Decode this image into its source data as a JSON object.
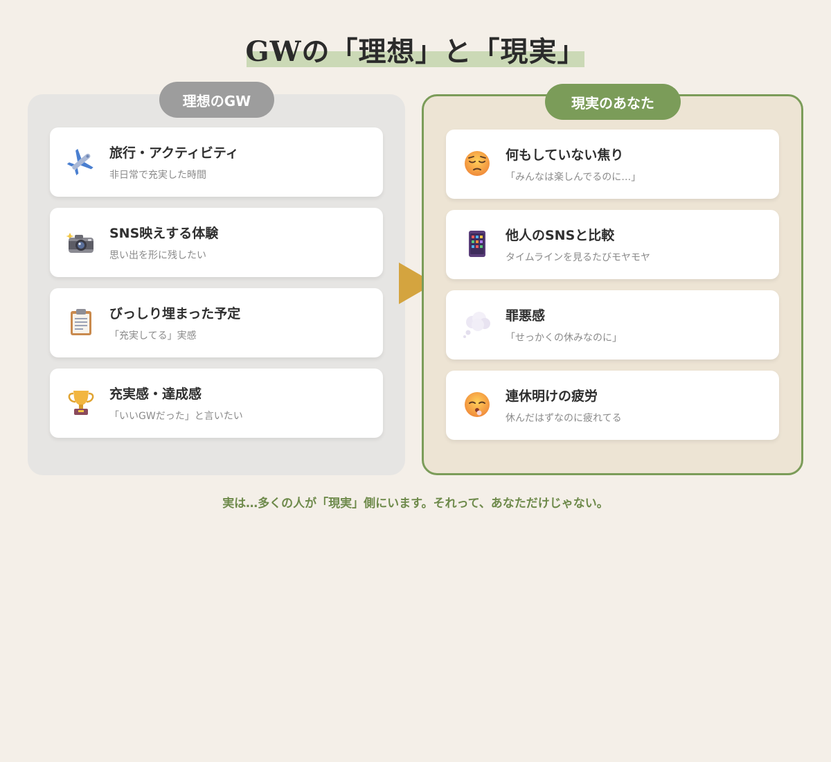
{
  "title": "GWの「理想」と「現実」",
  "left": {
    "label": "理想のGW",
    "items": [
      {
        "icon": "airplane-icon",
        "title": "旅行・アクティビティ",
        "subtitle": "非日常で充実した時間"
      },
      {
        "icon": "camera-flash-icon",
        "title": "SNS映えする体験",
        "subtitle": "思い出を形に残したい"
      },
      {
        "icon": "clipboard-icon",
        "title": "びっしり埋まった予定",
        "subtitle": "「充実してる」実感"
      },
      {
        "icon": "trophy-icon",
        "title": "充実感・達成感",
        "subtitle": "「いいGWだった」と言いたい"
      }
    ]
  },
  "right": {
    "label": "現実のあなた",
    "items": [
      {
        "icon": "pensive-face-icon",
        "title": "何もしていない焦り",
        "subtitle": "「みんなは楽しんでるのに…」"
      },
      {
        "icon": "smartphone-icon",
        "title": "他人のSNSと比較",
        "subtitle": "タイムラインを見るたびモヤモヤ"
      },
      {
        "icon": "thought-balloon-icon",
        "title": "罪悪感",
        "subtitle": "「せっかくの休みなのに」"
      },
      {
        "icon": "sleepy-face-icon",
        "title": "連休明けの疲労",
        "subtitle": "休んだはずなのに疲れてる"
      }
    ]
  },
  "footer": "実は…多くの人が「現実」側にいます。それって、あなただけじゃない。",
  "colors": {
    "background": "#f4efe8",
    "accent_green": "#7b9c59",
    "highlight": "#cbd9b6",
    "left_panel": "#e6e5e3",
    "right_panel": "#ede4d4",
    "arrow": "#d4a43f",
    "left_pill": "#9d9d9d"
  }
}
